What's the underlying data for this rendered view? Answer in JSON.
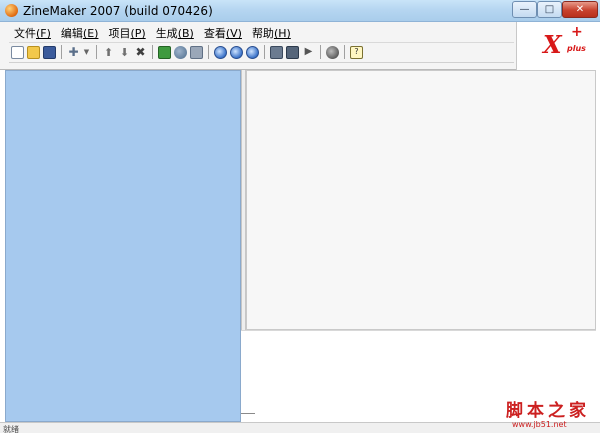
{
  "window": {
    "title": "ZineMaker 2007 (build 070426)",
    "minimize_glyph": "—",
    "maximize_glyph": "□",
    "close_glyph": "✕"
  },
  "menubar": {
    "items": [
      {
        "label": "文件",
        "accel": "(F)"
      },
      {
        "label": "编辑",
        "accel": "(E)"
      },
      {
        "label": "项目",
        "accel": "(P)"
      },
      {
        "label": "生成",
        "accel": "(B)"
      },
      {
        "label": "查看",
        "accel": "(V)"
      },
      {
        "label": "帮助",
        "accel": "(H)"
      }
    ]
  },
  "toolbar": {
    "icons": [
      "new-file-icon",
      "open-folder-icon",
      "save-icon",
      "add-icon",
      "dropdown-arrow-icon",
      "move-up-icon",
      "move-down-icon",
      "delete-icon",
      "image-icon",
      "globe-icon",
      "music-icon",
      "zoom-in-icon",
      "zoom-out-icon",
      "zoom-fit-icon",
      "tree-icon",
      "tree-settings-icon",
      "play-icon",
      "record-icon",
      "help-icon"
    ]
  },
  "logo": {
    "text": "X",
    "plus": "+",
    "sub": "plus",
    "color": "#d81818"
  },
  "statusbar": {
    "left": "就绪        ",
    "mid": "       "
  },
  "watermark": {
    "text": "脚本之家",
    "url": "www.jb51.net"
  },
  "colors": {
    "left_pane": "#a6c9ee",
    "titlebar": "#b6d6f1",
    "close_button": "#c8422e"
  }
}
